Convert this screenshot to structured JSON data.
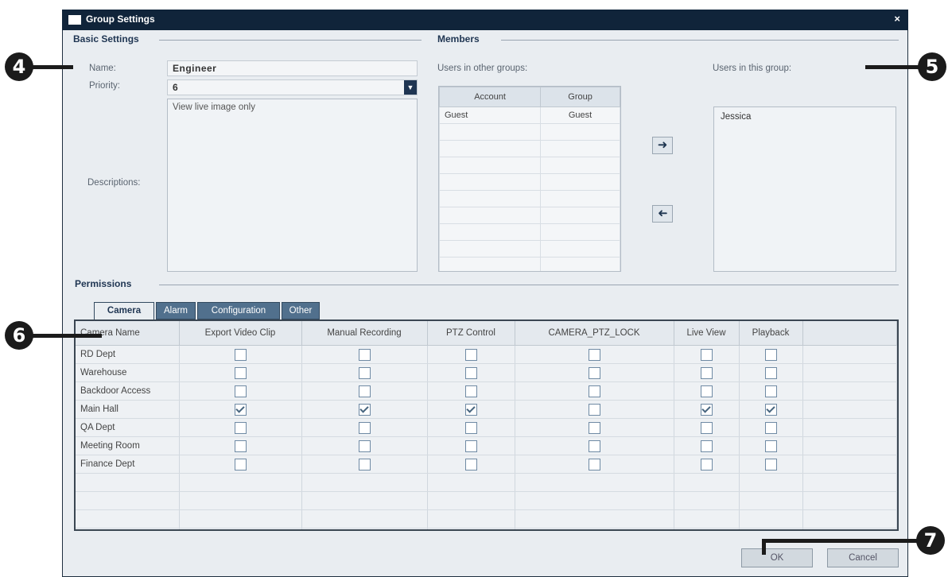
{
  "window": {
    "title": "Group Settings",
    "close_glyph": "×"
  },
  "basic": {
    "section_title": "Basic Settings",
    "name_label": "Name:",
    "name_value": "Engineer",
    "priority_label": "Priority:",
    "priority_value": "6",
    "descriptions_label": "Descriptions:",
    "description_value": "View live image only"
  },
  "members": {
    "section_title": "Members",
    "other_label": "Users in other groups:",
    "this_label": "Users in this group:",
    "columns": [
      "Account",
      "Group"
    ],
    "rows": [
      {
        "account": "Guest",
        "group": "Guest"
      }
    ],
    "in_group": [
      "Jessica"
    ],
    "add_icon": "arrow-right-icon",
    "remove_icon": "arrow-left-icon"
  },
  "permissions": {
    "section_title": "Permissions",
    "tabs": [
      "Camera",
      "Alarm",
      "Configuration",
      "Other"
    ],
    "active_tab": "Camera",
    "columns": [
      "Camera Name",
      "Export Video Clip",
      "Manual Recording",
      "PTZ Control",
      "CAMERA_PTZ_LOCK",
      "Live View",
      "Playback"
    ],
    "rows": [
      {
        "name": "RD Dept",
        "checks": [
          false,
          false,
          false,
          false,
          false,
          false
        ]
      },
      {
        "name": "Warehouse",
        "checks": [
          false,
          false,
          false,
          false,
          false,
          false
        ]
      },
      {
        "name": "Backdoor Access",
        "checks": [
          false,
          false,
          false,
          false,
          false,
          false
        ]
      },
      {
        "name": "Main Hall",
        "checks": [
          true,
          true,
          true,
          false,
          true,
          true
        ]
      },
      {
        "name": "QA Dept",
        "checks": [
          false,
          false,
          false,
          false,
          false,
          false
        ]
      },
      {
        "name": "Meeting Room",
        "checks": [
          false,
          false,
          false,
          false,
          false,
          false
        ]
      },
      {
        "name": "Finance Dept",
        "checks": [
          false,
          false,
          false,
          false,
          false,
          false
        ]
      }
    ]
  },
  "buttons": {
    "ok": "OK",
    "cancel": "Cancel"
  },
  "callouts": [
    "4",
    "5",
    "6",
    "7"
  ]
}
